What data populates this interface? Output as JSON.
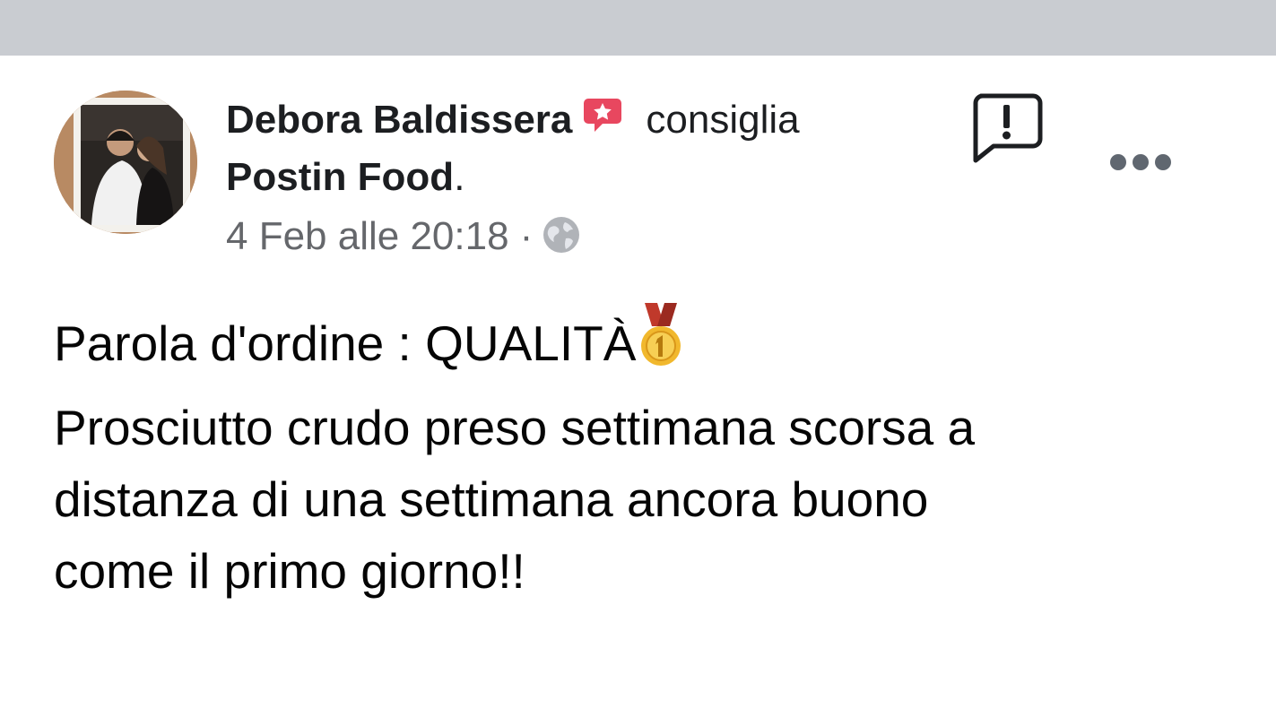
{
  "post": {
    "author_name": "Debora Baldissera",
    "recommend_verb": "consiglia",
    "page_name": "Postin Food",
    "page_name_suffix": ".",
    "timestamp": "4 Feb alle 20:18",
    "separator": "·",
    "privacy_icon": "globe-icon",
    "text_lines": [
      "Parola d'ordine : QUALITÀ",
      "Prosciutto crudo preso settimana scorsa a",
      "distanza di una settimana ancora buono",
      "come il primo giorno!!"
    ],
    "icons": {
      "recommend": "recommend-star-icon",
      "medal": "first-place-medal-icon",
      "report": "report-icon",
      "more": "more-options-icon"
    }
  },
  "colors": {
    "top_bar": "#c9ccd1",
    "recommend_badge": "#e8475f",
    "meta_text": "#65676b",
    "primary_text": "#1c1e21"
  }
}
